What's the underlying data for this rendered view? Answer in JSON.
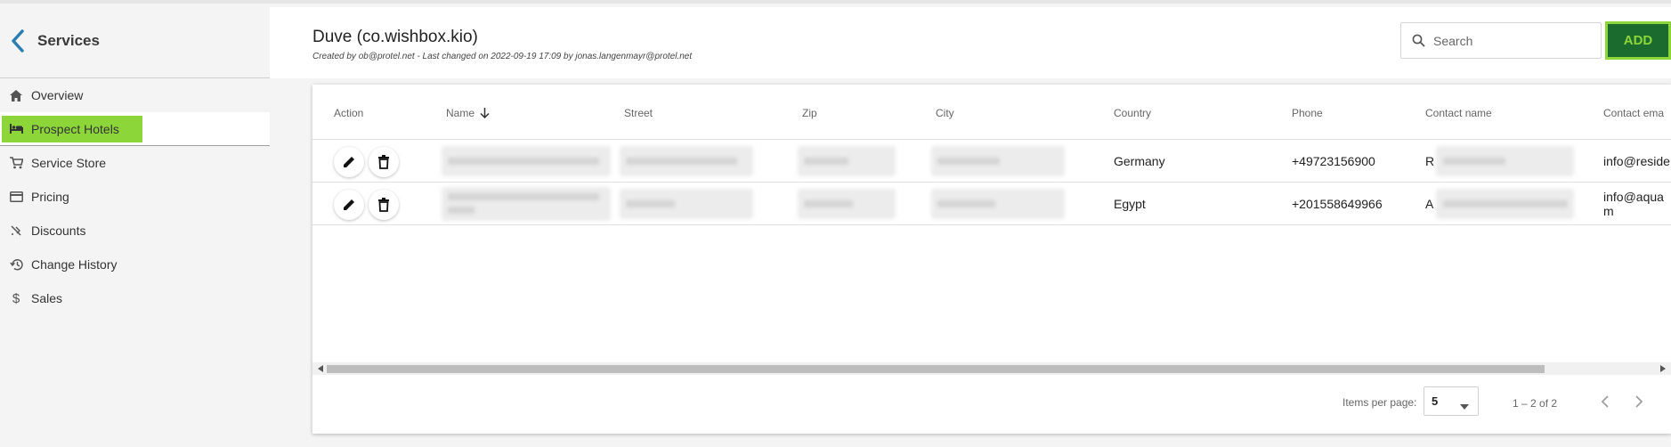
{
  "sidebar": {
    "title": "Services",
    "items": [
      {
        "label": "Overview",
        "icon": "home-icon"
      },
      {
        "label": "Prospect Hotels",
        "icon": "hotel-bed-icon",
        "active": true
      },
      {
        "label": "Service Store",
        "icon": "shopping-cart-icon"
      },
      {
        "label": "Pricing",
        "icon": "credit-card-icon"
      },
      {
        "label": "Discounts",
        "icon": "discount-icon"
      },
      {
        "label": "Change History",
        "icon": "history-icon"
      },
      {
        "label": "Sales",
        "icon": "dollar-icon"
      }
    ]
  },
  "header": {
    "title": "Duve (co.wishbox.kio)",
    "subtitle": "Created by ob@protel.net - Last changed on 2022-09-19 17:09 by jonas.langenmayr@protel.net"
  },
  "search": {
    "placeholder": "Search",
    "value": ""
  },
  "add_button": {
    "label": "ADD"
  },
  "table": {
    "columns": [
      "Action",
      "Name",
      "Street",
      "Zip",
      "City",
      "Country",
      "Phone",
      "Contact name",
      "Contact ema"
    ],
    "sorted_column": "Name",
    "sort_direction": "desc",
    "rows": [
      {
        "country": "Germany",
        "phone": "+49723156900",
        "contact_prefix": "R",
        "email": "info@reside"
      },
      {
        "country": "Egypt",
        "phone": "+201558649966",
        "contact_prefix": "A",
        "email_line1": "info@aqua",
        "email_line2": "m"
      }
    ]
  },
  "paginator": {
    "items_per_page_label": "Items per page:",
    "items_per_page": "5",
    "range": "1 – 2 of 2"
  },
  "colors": {
    "accent_green": "#8cd63a",
    "dark_green": "#1b6b2f",
    "back_arrow": "#2a7fb0"
  }
}
